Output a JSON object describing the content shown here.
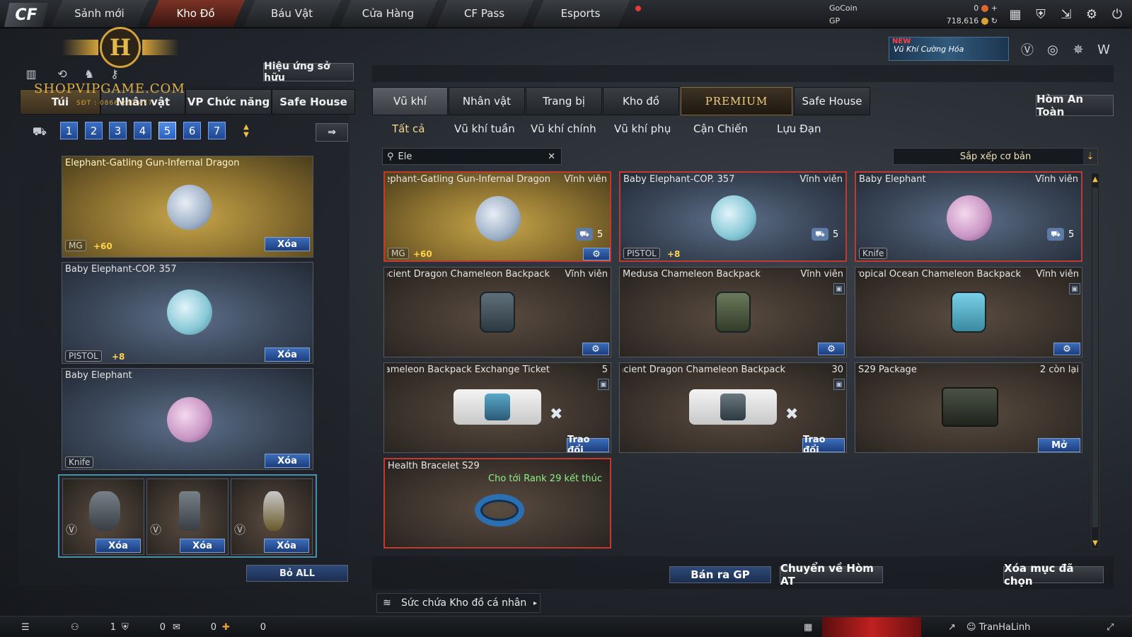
{
  "nav": {
    "logo": "CF",
    "tabs": [
      "Sảnh mới",
      "Kho Đồ",
      "Báu Vật",
      "Cửa Hàng",
      "CF Pass",
      "Esports"
    ],
    "active_tab": "Kho Đồ"
  },
  "currency": {
    "gocoin_label": "GoCoin",
    "gocoin_value": "0",
    "gp_label": "GP",
    "gp_value": "718,616"
  },
  "promo": {
    "badge": "NEW",
    "text": "Vũ Khí Cường Hóa"
  },
  "watermark": {
    "logo_letter": "H",
    "site": "SHOPVIPGAME.COM",
    "phone": "SĐT : 0866.237.477"
  },
  "left": {
    "effect_button": "Hiệu ứng sở hữu",
    "tabs": [
      "Túi",
      "Nhân vật",
      "VP Chức năng",
      "Safe House"
    ],
    "pages": [
      "1",
      "2",
      "3",
      "4",
      "5",
      "6",
      "7"
    ],
    "active_page": "5",
    "slots": [
      {
        "name": "Elephant-Gatling Gun-Infernal Dragon",
        "tag": "MG",
        "boost": "+60",
        "action": "Xóa"
      },
      {
        "name": "Baby Elephant-COP. 357",
        "tag": "PISTOL",
        "boost": "+8",
        "action": "Xóa"
      },
      {
        "name": "Baby Elephant",
        "tag": "Knife",
        "boost": "",
        "action": "Xóa"
      }
    ],
    "grenades": [
      {
        "action": "Xóa"
      },
      {
        "action": "Xóa"
      },
      {
        "action": "Xóa"
      }
    ],
    "remove_all": "Bỏ ALL"
  },
  "main": {
    "tabs": [
      "Vũ khí",
      "Nhân vật",
      "Trang bị",
      "Kho đồ",
      "PREMIUM",
      "Safe House"
    ],
    "active_tab": "Vũ khí",
    "safe_box_button": "Hòm An Toàn",
    "subtabs": [
      "Tất cả",
      "Vũ khí tuần",
      "Vũ khí chính",
      "Vũ khí phụ",
      "Cận Chiến",
      "Lựu Đạn"
    ],
    "active_subtab": "Tất cả",
    "search_value": "Ele",
    "sort_label": "Sắp xếp cơ bản",
    "items": [
      {
        "name": "Elephant-Gatling Gun-Infernal Dragon",
        "duration": "Vĩnh viễn",
        "count": "5",
        "tag": "MG",
        "boost": "+60"
      },
      {
        "name": "Baby Elephant-COP. 357",
        "duration": "Vĩnh viễn",
        "count": "5",
        "tag": "PISTOL",
        "boost": "+8"
      },
      {
        "name": "Baby Elephant",
        "duration": "Vĩnh viễn",
        "count": "5",
        "tag": "Knife"
      },
      {
        "name": "Ancient Dragon Chameleon Backpack",
        "duration": "Vĩnh viễn"
      },
      {
        "name": "Medusa Chameleon Backpack",
        "duration": "Vĩnh viễn"
      },
      {
        "name": "Tropical Ocean Chameleon Backpack",
        "duration": "Vĩnh viễn"
      },
      {
        "name": "Chameleon Backpack Exchange Ticket",
        "duration": "5",
        "action": "Trao đổi"
      },
      {
        "name": "Ancient Dragon Chameleon Backpack",
        "duration": "30",
        "action": "Trao đổi"
      },
      {
        "name": "S29 Package",
        "duration": "2 còn lại",
        "action": "Mở"
      },
      {
        "name": "Health Bracelet S29",
        "duration": "Cho tới Rank 29 kết thúc"
      }
    ],
    "sell_button": "Bán ra GP",
    "transfer_button": "Chuyển về Hòm AT",
    "delete_selected_button": "Xóa mục đã chọn",
    "capacity_label": "Sức chứa Kho đồ cá nhân"
  },
  "status": {
    "friends": "1",
    "clan": "0",
    "chat": "0",
    "gifts": "0",
    "username": "TranHaLinh"
  }
}
